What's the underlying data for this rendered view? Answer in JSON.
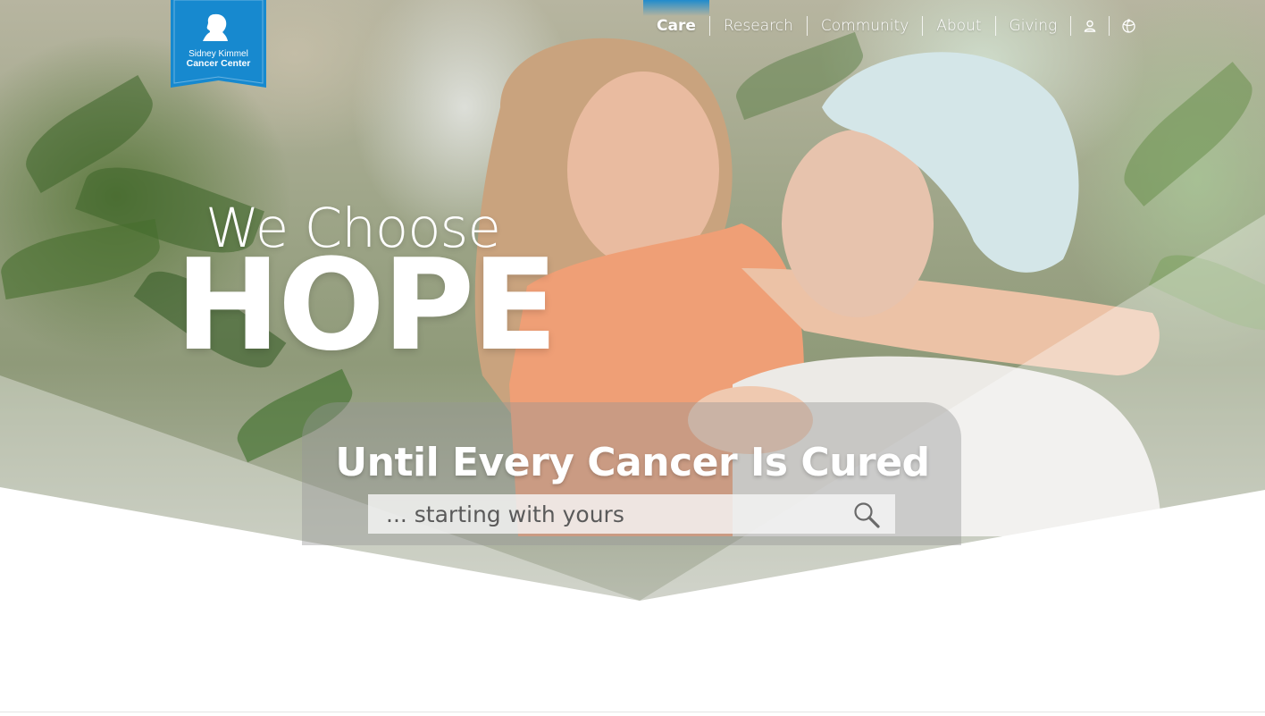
{
  "brand": {
    "logo_line1": "Sidney Kimmel",
    "logo_line2": "Cancer Center",
    "color": "#1789cf"
  },
  "nav": {
    "items": [
      {
        "label": "Care",
        "active": true
      },
      {
        "label": "Research",
        "active": false
      },
      {
        "label": "Community",
        "active": false
      },
      {
        "label": "About",
        "active": false
      },
      {
        "label": "Giving",
        "active": false
      }
    ],
    "icons": [
      "user-icon",
      "globe-icon"
    ]
  },
  "hero": {
    "headline_small": "We Choose",
    "headline_large": "HOPE",
    "tagline": "Until Every Cancer Is Cured"
  },
  "search": {
    "placeholder": "... starting with yours",
    "value": "",
    "button_icon": "search-icon"
  }
}
